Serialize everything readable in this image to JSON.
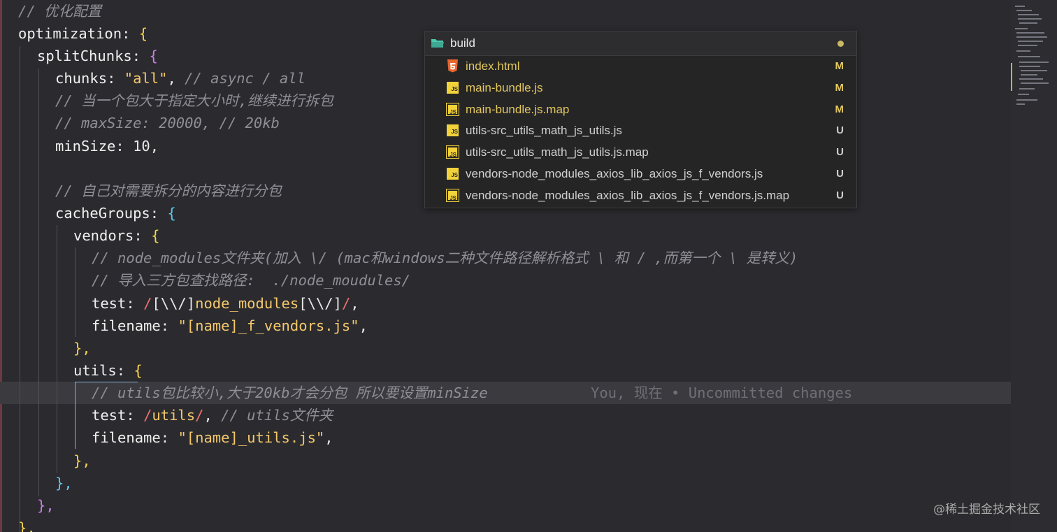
{
  "code": {
    "l1": "// 优化配置",
    "l2_key": "optimization",
    "l2_brace": "{",
    "l3_key": "splitChunks",
    "l3_brace": "{",
    "l4_key": "chunks",
    "l4_val": "\"all\"",
    "l4_cm": "// async / all",
    "l5": "// 当一个包大于指定大小时,继续进行拆包",
    "l6": "// maxSize: 20000, // 20kb",
    "l7_key": "minSize",
    "l7_val": "10",
    "l9": "// 自己对需要拆分的内容进行分包",
    "l10_key": "cacheGroups",
    "l10_brace": "{",
    "l11_key": "vendors",
    "l11_brace": "{",
    "l12": "// node_modules文件夹(加入 \\/ (mac和windows二种文件路径解析格式 \\ 和 / ,而第一个 \\ 是转义)",
    "l13": "// 导入三方包查找路径:  ./node_moudules/",
    "l14_key": "test",
    "l14_re1": "/",
    "l14_re2": "[\\\\/]",
    "l14_re3": "node_modules",
    "l14_re4": "[\\\\/]",
    "l14_re5": "/",
    "l15_key": "filename",
    "l15_val": "\"[name]_f_vendors.js\"",
    "l16": "},",
    "l17_key": "utils",
    "l17_brace": "{",
    "l18": "// utils包比较小,大于20kb才会分包 所以要设置minSize",
    "blame": "You, 现在 • Uncommitted changes",
    "l19_key": "test",
    "l19_re1": "/",
    "l19_re2": "utils",
    "l19_re3": "/",
    "l19_cm": "// utils文件夹",
    "l20_key": "filename",
    "l20_val": "\"[name]_utils.js\"",
    "l21": "},",
    "l22": "},",
    "l23": "},",
    "l24": "},"
  },
  "explorer": {
    "folder": "build",
    "files": [
      {
        "name": "index.html",
        "status": "M",
        "kind": "html"
      },
      {
        "name": "main-bundle.js",
        "status": "M",
        "kind": "js"
      },
      {
        "name": "main-bundle.js.map",
        "status": "M",
        "kind": "map"
      },
      {
        "name": "utils-src_utils_math_js_utils.js",
        "status": "U",
        "kind": "js"
      },
      {
        "name": "utils-src_utils_math_js_utils.js.map",
        "status": "U",
        "kind": "map"
      },
      {
        "name": "vendors-node_modules_axios_lib_axios_js_f_vendors.js",
        "status": "U",
        "kind": "js"
      },
      {
        "name": "vendors-node_modules_axios_lib_axios_js_f_vendors.js.map",
        "status": "U",
        "kind": "map"
      }
    ]
  },
  "watermark": "@稀土掘金技术社区",
  "colors": {
    "modified": "#e2c75f",
    "untracked": "#cfcfcf",
    "folder_icon": "#4ec9b0"
  }
}
